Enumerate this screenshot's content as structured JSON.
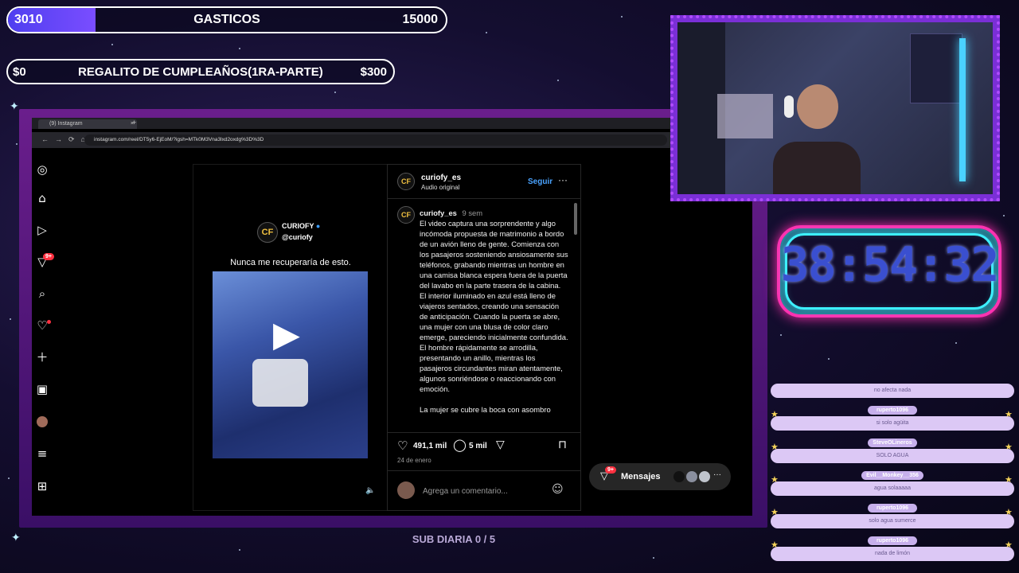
{
  "goals": [
    {
      "left": "3010",
      "title": "GASTICOS",
      "right": "15000",
      "progress": 0.2
    },
    {
      "left": "$0",
      "title": "REGALITO DE CUMPLEAÑOS(1RA-PARTE)",
      "right": "$300",
      "progress": 0
    }
  ],
  "browser": {
    "tab_title": "(9) Instagram",
    "url": "instagram.com/reel/DT5y6-EjEoM/?igsh=MTk0M3Vna3lxd2oxdg%3D%3D"
  },
  "instagram": {
    "notifications_badge": "9+",
    "media": {
      "brand": "CURIOFY",
      "handle": "@curiofy",
      "caption": "Nunca me recuperaría de esto."
    },
    "post": {
      "author": "curiofy_es",
      "subtitle": "Audio original",
      "follow": "Seguir",
      "comment_author": "curiofy_es",
      "comment_time": "9 sem",
      "comment_text": "El video captura una sorprendente y algo incómoda propuesta de matrimonio a bordo de un avión lleno de gente. Comienza con los pasajeros sosteniendo ansiosamente sus teléfonos, grabando mientras un hombre en una camisa blanca espera fuera de la puerta del lavabo en la parte trasera de la cabina. El interior iluminado en azul está lleno de viajeros sentados, creando una sensación de anticipación. Cuando la puerta se abre, una mujer con una blusa de color claro emerge, pareciendo inicialmente confundida. El hombre rápidamente se arrodilla, presentando un anillo, mientras los pasajeros circundantes miran atentamente, algunos sonriéndose o reaccionando con emoción.",
      "comment_more": "La mujer se cubre la boca con asombro",
      "likes": "491,1 mil",
      "comments": "5 mil",
      "date": "24 de enero",
      "comment_placeholder": "Agrega un comentario..."
    },
    "messages": {
      "label": "Mensajes",
      "badge": "9+"
    }
  },
  "timer": "38:54:32",
  "chat": [
    {
      "user": "",
      "text": "no afecta nada"
    },
    {
      "user": "ruperto1096",
      "text": "si solo agüita"
    },
    {
      "user": "SteveOLineros",
      "text": "SOLO AGUA"
    },
    {
      "user": "Evil__Monkey__356",
      "text": "agua solaaaaa"
    },
    {
      "user": "ruperto1096",
      "text": "solo agua sumerce"
    },
    {
      "user": "ruperto1096",
      "text": "nada de limón"
    }
  ],
  "sub_daily": "SUB DIARIA 0 / 5",
  "icons": [
    "instagram-icon",
    "home-icon",
    "reels-icon",
    "explore-icon",
    "search-icon",
    "heart-icon",
    "plus-icon",
    "insights-icon",
    "menu-icon",
    "apps-icon"
  ]
}
